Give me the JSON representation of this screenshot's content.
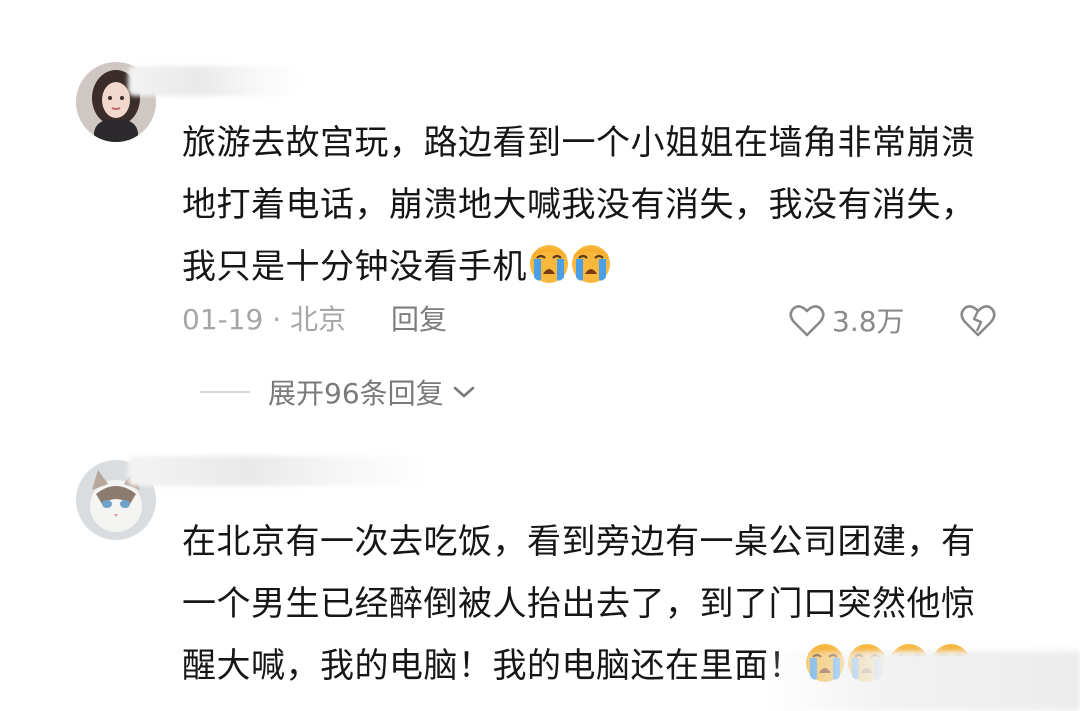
{
  "comments": [
    {
      "text": "旅游去故宫玩，路边看到一个小姐姐在墙角非常崩溃地打着电话，崩溃地大喊我没有消失，我没有消失，我只是十分钟没看手机",
      "date": "01-19",
      "location_sep": "·",
      "location": "北京",
      "reply_label": "回复",
      "like_count": "3.8万",
      "expand_label": "展开96条回复",
      "emoji_count": 2,
      "emoji_name": "loudly-crying-face"
    },
    {
      "text": "在北京有一次去吃饭，看到旁边有一桌公司团建，有一个男生已经醉倒被人抬出去了，到了门口突然他惊醒大喊，我的电脑！我的电脑还在里面！",
      "emoji_count": 4,
      "emoji_name": "loudly-crying-face"
    }
  ],
  "icons": {
    "like": "heart-outline-icon",
    "dislike": "broken-heart-icon",
    "expand": "chevron-down-icon"
  },
  "colors": {
    "text": "#161616",
    "meta": "#a6a6a6",
    "emoji_face": "#f7b33b",
    "emoji_tear": "#4a9fe8"
  }
}
